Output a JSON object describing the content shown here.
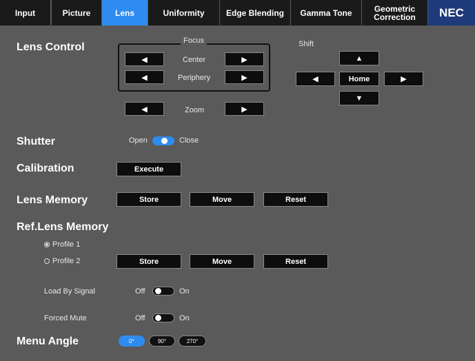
{
  "tabs": [
    {
      "label": "Input"
    },
    {
      "label": "Picture"
    },
    {
      "label": "Lens",
      "active": true
    },
    {
      "label": "Uniformity"
    },
    {
      "label": "Edge Blending"
    },
    {
      "label": "Gamma Tone"
    },
    {
      "label": "Geometric Correction"
    }
  ],
  "logo": "NEC",
  "lens_control": {
    "heading": "Lens Control",
    "focus_title": "Focus",
    "center_label": "Center",
    "periphery_label": "Periphery",
    "zoom_label": "Zoom",
    "shift_title": "Shift",
    "home_label": "Home",
    "left_arrow": "◀",
    "right_arrow": "▶",
    "up_arrow": "▲",
    "down_arrow": "▼"
  },
  "shutter": {
    "heading": "Shutter",
    "open_label": "Open",
    "close_label": "Close"
  },
  "calibration": {
    "heading": "Calibration",
    "execute_label": "Execute"
  },
  "lens_memory": {
    "heading": "Lens Memory",
    "store_label": "Store",
    "move_label": "Move",
    "reset_label": "Reset"
  },
  "ref_lens_memory": {
    "heading": "Ref.Lens Memory",
    "profile1_label": "Profile 1",
    "profile2_label": "Profile 2",
    "selected_profile": "Profile 1",
    "store_label": "Store",
    "move_label": "Move",
    "reset_label": "Reset",
    "load_by_signal_label": "Load By Signal",
    "load_off": "Off",
    "load_on": "On",
    "forced_mute_label": "Forced Mute",
    "mute_off": "Off",
    "mute_on": "On"
  },
  "menu_angle": {
    "heading": "Menu Angle",
    "options": [
      "0°",
      "90°",
      "270°"
    ],
    "selected": "0°"
  },
  "colors": {
    "background": "#5a5a5a",
    "accent": "#2e8cf0",
    "tab_bg": "#1a1a1a",
    "logo_bg": "#1f3a7a",
    "button_bg": "#0d0d0d"
  }
}
